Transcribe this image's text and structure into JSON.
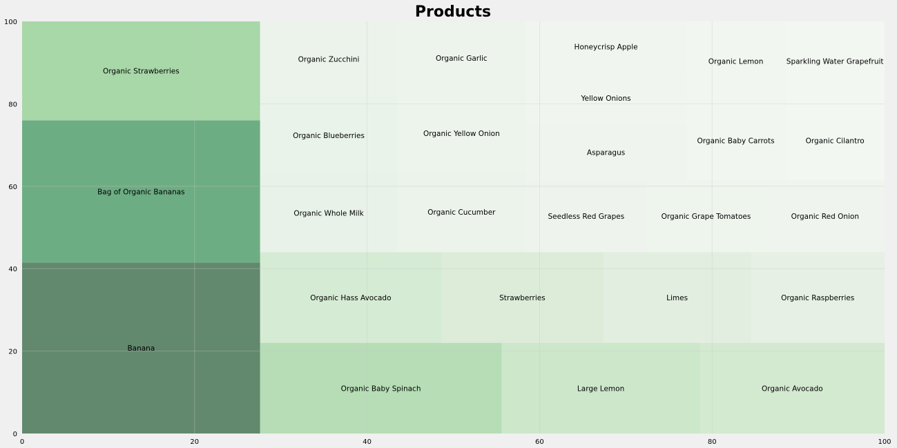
{
  "chart_data": {
    "type": "treemap",
    "title": "Products",
    "xlabel": "",
    "ylabel": "",
    "xlim": [
      0,
      100
    ],
    "ylim": [
      0,
      100
    ],
    "x_ticks": [
      "0",
      "20",
      "40",
      "60",
      "80",
      "100"
    ],
    "y_ticks": [
      "0",
      "20",
      "40",
      "60",
      "80",
      "100"
    ],
    "grid": true,
    "colors": {
      "background": "#f0f0f0",
      "grid": "#c8c8c8",
      "text": "#000000"
    },
    "tiles": [
      {
        "label": "Banana",
        "x": 0,
        "y": 0,
        "w": 27.6,
        "h": 41.5,
        "color": "#62896d"
      },
      {
        "label": "Bag of Organic Bananas",
        "x": 0,
        "y": 41.5,
        "w": 27.6,
        "h": 34.5,
        "color": "#6dad83"
      },
      {
        "label": "Organic Strawberries",
        "x": 0,
        "y": 76.0,
        "w": 27.6,
        "h": 24.0,
        "color": "#a8d7a8"
      },
      {
        "label": "Organic Baby Spinach",
        "x": 27.6,
        "y": 0,
        "w": 28.0,
        "h": 22.0,
        "color": "#b6ddb6"
      },
      {
        "label": "Large Lemon",
        "x": 55.6,
        "y": 0,
        "w": 23.0,
        "h": 22.0,
        "color": "#cde7cb"
      },
      {
        "label": "Organic Avocado",
        "x": 78.6,
        "y": 0,
        "w": 21.4,
        "h": 22.0,
        "color": "#d3e9d0"
      },
      {
        "label": "Organic Hass Avocado",
        "x": 27.6,
        "y": 22.0,
        "w": 21.0,
        "h": 22.0,
        "color": "#d5ebd3"
      },
      {
        "label": "Strawberries",
        "x": 48.6,
        "y": 22.0,
        "w": 18.8,
        "h": 22.0,
        "color": "#dcecd9"
      },
      {
        "label": "Limes",
        "x": 67.4,
        "y": 22.0,
        "w": 17.1,
        "h": 22.0,
        "color": "#e2eee0"
      },
      {
        "label": "Organic Raspberries",
        "x": 84.5,
        "y": 22.0,
        "w": 15.5,
        "h": 22.0,
        "color": "#e6f0e4"
      },
      {
        "label": "Organic Whole Milk",
        "x": 27.6,
        "y": 44.0,
        "w": 15.9,
        "h": 19.0,
        "color": "#e9f2e8"
      },
      {
        "label": "Organic Blueberries",
        "x": 27.6,
        "y": 63.0,
        "w": 15.9,
        "h": 18.8,
        "color": "#eaf3e9"
      },
      {
        "label": "Organic Zucchini",
        "x": 27.6,
        "y": 81.8,
        "w": 15.9,
        "h": 18.2,
        "color": "#ebf3ea"
      },
      {
        "label": "Organic Cucumber",
        "x": 43.5,
        "y": 44.0,
        "w": 14.9,
        "h": 19.5,
        "color": "#ebf3ea"
      },
      {
        "label": "Organic Yellow Onion",
        "x": 43.5,
        "y": 63.5,
        "w": 14.9,
        "h": 18.8,
        "color": "#ecf4eb"
      },
      {
        "label": "Organic Garlic",
        "x": 43.5,
        "y": 82.3,
        "w": 14.9,
        "h": 17.7,
        "color": "#edf4ec"
      },
      {
        "label": "Seedless Red Grapes",
        "x": 58.4,
        "y": 44.0,
        "w": 14.0,
        "h": 17.5,
        "color": "#eef4ed"
      },
      {
        "label": "Organic Grape Tomatoes",
        "x": 72.4,
        "y": 44.0,
        "w": 13.8,
        "h": 17.5,
        "color": "#eef5ed"
      },
      {
        "label": "Organic Red Onion",
        "x": 86.2,
        "y": 44.0,
        "w": 13.8,
        "h": 17.5,
        "color": "#eff5ee"
      },
      {
        "label": "Asparagus",
        "x": 58.4,
        "y": 61.5,
        "w": 18.6,
        "h": 13.5,
        "color": "#eff5ee"
      },
      {
        "label": "Yellow Onions",
        "x": 58.4,
        "y": 75.0,
        "w": 18.6,
        "h": 12.8,
        "color": "#f0f5ef"
      },
      {
        "label": "Honeycrisp Apple",
        "x": 58.4,
        "y": 87.8,
        "w": 18.6,
        "h": 12.2,
        "color": "#f0f6ef"
      },
      {
        "label": "Organic Baby Carrots",
        "x": 77.0,
        "y": 61.5,
        "w": 11.5,
        "h": 19.2,
        "color": "#f1f6f0"
      },
      {
        "label": "Organic Lemon",
        "x": 77.0,
        "y": 80.7,
        "w": 11.5,
        "h": 19.3,
        "color": "#f2f6f1"
      },
      {
        "label": "Organic Cilantro",
        "x": 88.5,
        "y": 61.5,
        "w": 11.5,
        "h": 19.2,
        "color": "#f2f7f1"
      },
      {
        "label": "Sparkling Water Grapefruit",
        "x": 88.5,
        "y": 80.7,
        "w": 11.5,
        "h": 19.3,
        "color": "#f3f7f2"
      }
    ]
  }
}
